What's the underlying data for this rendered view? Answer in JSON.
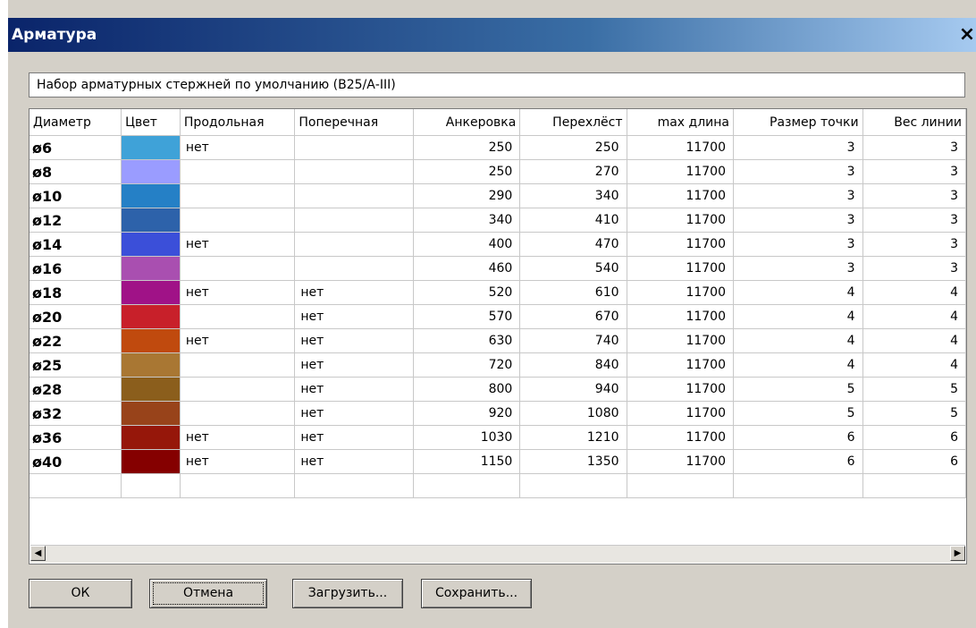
{
  "window": {
    "title": "Арматура",
    "close_label": "×"
  },
  "set_name": "Набор арматурных стержней по умолчанию (В25/А-III)",
  "columns": [
    "Диаметр",
    "Цвет",
    "Продольная",
    "Поперечная",
    "Анкеровка",
    "Перехлёст",
    "max длина",
    "Размер точки",
    "Вес линии"
  ],
  "rows": [
    {
      "diameter": "ø6",
      "color": "#3fa2d8",
      "longitudinal": "нет",
      "transverse": "",
      "anchorage": "250",
      "overlap": "250",
      "max_length": "11700",
      "point_size": "3",
      "line_weight": "3"
    },
    {
      "diameter": "ø8",
      "color": "#9a9cff",
      "longitudinal": "",
      "transverse": "",
      "anchorage": "250",
      "overlap": "270",
      "max_length": "11700",
      "point_size": "3",
      "line_weight": "3"
    },
    {
      "diameter": "ø10",
      "color": "#2580c6",
      "longitudinal": "",
      "transverse": "",
      "anchorage": "290",
      "overlap": "340",
      "max_length": "11700",
      "point_size": "3",
      "line_weight": "3"
    },
    {
      "diameter": "ø12",
      "color": "#2d62aa",
      "longitudinal": "",
      "transverse": "",
      "anchorage": "340",
      "overlap": "410",
      "max_length": "11700",
      "point_size": "3",
      "line_weight": "3"
    },
    {
      "diameter": "ø14",
      "color": "#3b4fd9",
      "longitudinal": "нет",
      "transverse": "",
      "anchorage": "400",
      "overlap": "470",
      "max_length": "11700",
      "point_size": "3",
      "line_weight": "3"
    },
    {
      "diameter": "ø16",
      "color": "#a94fb0",
      "longitudinal": "",
      "transverse": "",
      "anchorage": "460",
      "overlap": "540",
      "max_length": "11700",
      "point_size": "3",
      "line_weight": "3"
    },
    {
      "diameter": "ø18",
      "color": "#a01287",
      "longitudinal": "нет",
      "transverse": "нет",
      "anchorage": "520",
      "overlap": "610",
      "max_length": "11700",
      "point_size": "4",
      "line_weight": "4"
    },
    {
      "diameter": "ø20",
      "color": "#c8202a",
      "longitudinal": "",
      "transverse": "нет",
      "anchorage": "570",
      "overlap": "670",
      "max_length": "11700",
      "point_size": "4",
      "line_weight": "4"
    },
    {
      "diameter": "ø22",
      "color": "#c04a0e",
      "longitudinal": "нет",
      "transverse": "нет",
      "anchorage": "630",
      "overlap": "740",
      "max_length": "11700",
      "point_size": "4",
      "line_weight": "4"
    },
    {
      "diameter": "ø25",
      "color": "#a97733",
      "longitudinal": "",
      "transverse": "нет",
      "anchorage": "720",
      "overlap": "840",
      "max_length": "11700",
      "point_size": "4",
      "line_weight": "4"
    },
    {
      "diameter": "ø28",
      "color": "#8b5e1c",
      "longitudinal": "",
      "transverse": "нет",
      "anchorage": "800",
      "overlap": "940",
      "max_length": "11700",
      "point_size": "5",
      "line_weight": "5"
    },
    {
      "diameter": "ø32",
      "color": "#98431a",
      "longitudinal": "",
      "transverse": "нет",
      "anchorage": "920",
      "overlap": "1080",
      "max_length": "11700",
      "point_size": "5",
      "line_weight": "5"
    },
    {
      "diameter": "ø36",
      "color": "#96170a",
      "longitudinal": "нет",
      "transverse": "нет",
      "anchorage": "1030",
      "overlap": "1210",
      "max_length": "11700",
      "point_size": "6",
      "line_weight": "6"
    },
    {
      "diameter": "ø40",
      "color": "#850000",
      "longitudinal": "нет",
      "transverse": "нет",
      "anchorage": "1150",
      "overlap": "1350",
      "max_length": "11700",
      "point_size": "6",
      "line_weight": "6"
    }
  ],
  "buttons": {
    "ok": "ОК",
    "cancel": "Отмена",
    "load": "Загрузить...",
    "save": "Сохранить..."
  },
  "scroll_icons": {
    "left": "◀",
    "right": "▶"
  }
}
